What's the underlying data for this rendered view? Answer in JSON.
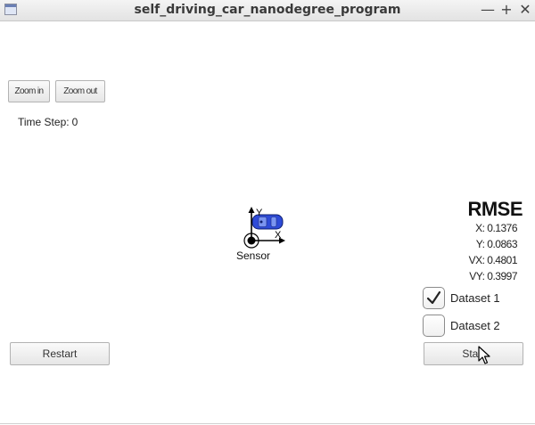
{
  "window": {
    "title": "self_driving_car_nanodegree_program",
    "minimize_glyph": "—",
    "maximize_glyph": "+",
    "close_glyph": "✕"
  },
  "toolbar": {
    "zoom_in_label": "Zoom in",
    "zoom_out_label": "Zoom out"
  },
  "status": {
    "time_step_label": "Time Step:",
    "time_step_value": "0"
  },
  "scene": {
    "sensor_label": "Sensor",
    "axis_x_label": "X",
    "axis_y_label": "Y",
    "car_color": "#2e4bd8"
  },
  "rmse": {
    "title": "RMSE",
    "x": "X: 0.1376",
    "y": "Y: 0.0863",
    "vx": "VX: 0.4801",
    "vy": "VY: 0.3997"
  },
  "datasets": [
    {
      "label": "Dataset 1",
      "checked": true
    },
    {
      "label": "Dataset 2",
      "checked": false
    }
  ],
  "controls": {
    "restart_label": "Restart",
    "start_label": "Start"
  }
}
